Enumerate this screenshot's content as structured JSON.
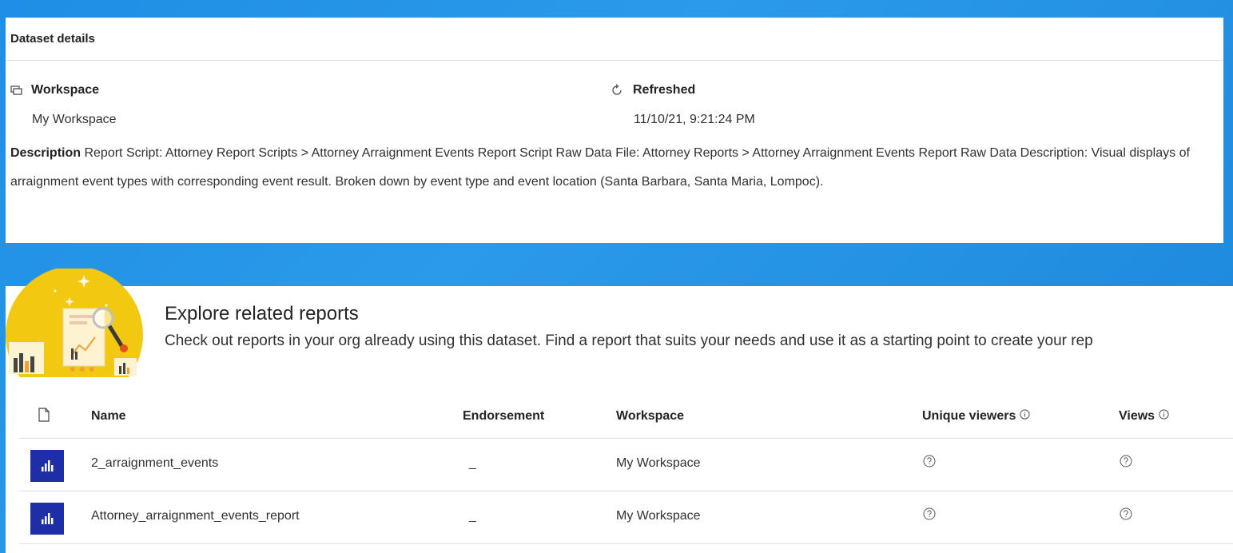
{
  "dataset_details": {
    "header": "Dataset details",
    "workspace_label": "Workspace",
    "workspace_value": "My Workspace",
    "refreshed_label": "Refreshed",
    "refreshed_value": "11/10/21, 9:21:24 PM",
    "description_label": "Description",
    "description_text": "Report Script: Attorney Report Scripts > Attorney Arraignment Events Report Script Raw Data File: Attorney Reports > Attorney Arraignment Events Report Raw Data Description: Visual displays of arraignment event types with corresponding event result. Broken down by event type and event location (Santa Barbara, Santa Maria, Lompoc)."
  },
  "explore": {
    "title": "Explore related reports",
    "subtitle": "Check out reports in your org already using this dataset. Find a report that suits your needs and use it as a starting point to create your rep"
  },
  "table": {
    "columns": {
      "name": "Name",
      "endorsement": "Endorsement",
      "workspace": "Workspace",
      "unique_viewers": "Unique viewers",
      "views": "Views"
    },
    "rows": [
      {
        "name": "2_arraignment_events",
        "endorsement": "_",
        "workspace": "My Workspace"
      },
      {
        "name": "Attorney_arraignment_events_report",
        "endorsement": "_",
        "workspace": "My Workspace"
      }
    ]
  },
  "colors": {
    "background": "#1e8ee6",
    "report_icon": "#1d2ea6",
    "illustration_circle": "#f2c811"
  }
}
